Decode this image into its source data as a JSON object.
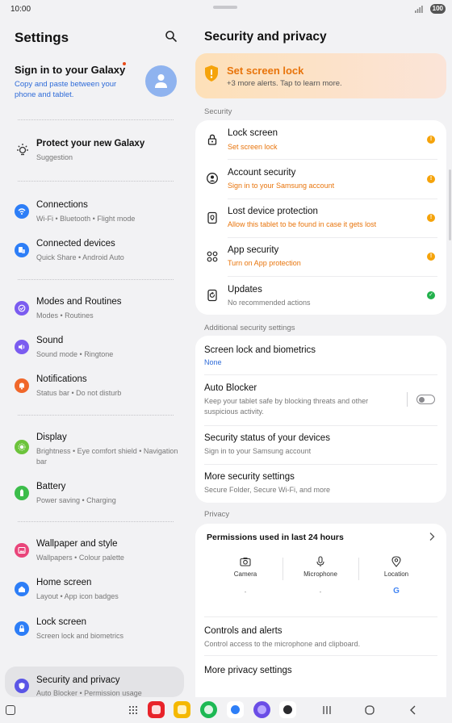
{
  "status": {
    "time": "10:00",
    "battery": "100"
  },
  "left": {
    "title": "Settings",
    "signin": {
      "title": "Sign in to your Galaxy",
      "subtitle": "Copy and paste between your phone and tablet."
    },
    "suggestion": {
      "title": "Protect your new Galaxy",
      "subtitle": "Suggestion"
    },
    "items": [
      {
        "title": "Connections",
        "subtitle": "Wi-Fi  •  Bluetooth  •  Flight mode",
        "color": "#2d7ef7"
      },
      {
        "title": "Connected devices",
        "subtitle": "Quick Share  •  Android Auto",
        "color": "#2d7ef7"
      },
      {
        "title": "Modes and Routines",
        "subtitle": "Modes  •  Routines",
        "color": "#7b5cf0"
      },
      {
        "title": "Sound",
        "subtitle": "Sound mode  •  Ringtone",
        "color": "#7b5cf0"
      },
      {
        "title": "Notifications",
        "subtitle": "Status bar  •  Do not disturb",
        "color": "#f0672a"
      },
      {
        "title": "Display",
        "subtitle": "Brightness  •  Eye comfort shield  •  Navigation bar",
        "color": "#6cc33b"
      },
      {
        "title": "Battery",
        "subtitle": "Power saving  •  Charging",
        "color": "#3cbd4a"
      },
      {
        "title": "Wallpaper and style",
        "subtitle": "Wallpapers  •  Colour palette",
        "color": "#e9457a"
      },
      {
        "title": "Home screen",
        "subtitle": "Layout  •  App icon badges",
        "color": "#2d7ef7"
      },
      {
        "title": "Lock screen",
        "subtitle": "Screen lock and biometrics",
        "color": "#2d7ef7"
      },
      {
        "title": "Security and privacy",
        "subtitle": "Auto Blocker  •  Permission usage",
        "color": "#5a55e6"
      }
    ]
  },
  "right": {
    "title": "Security and privacy",
    "alert": {
      "title": "Set screen lock",
      "subtitle": "+3 more alerts. Tap to learn more."
    },
    "security_label": "Security",
    "security_items": [
      {
        "title": "Lock screen",
        "subtitle": "Set screen lock",
        "status": "warning",
        "icon": "lock-icon"
      },
      {
        "title": "Account security",
        "subtitle": "Sign in to your Samsung account",
        "status": "warning",
        "icon": "account-icon"
      },
      {
        "title": "Lost device protection",
        "subtitle": "Allow this tablet to be found in case it gets lost",
        "status": "warning",
        "icon": "lost-device-icon"
      },
      {
        "title": "App security",
        "subtitle": "Turn on App protection",
        "status": "warning",
        "icon": "apps-icon"
      },
      {
        "title": "Updates",
        "subtitle": "No recommended actions",
        "status": "ok",
        "icon": "update-icon"
      }
    ],
    "additional_label": "Additional security settings",
    "additional": {
      "biometrics": {
        "title": "Screen lock and biometrics",
        "subtitle": "None"
      },
      "auto_blocker": {
        "title": "Auto Blocker",
        "subtitle": "Keep your tablet safe by blocking threats and other suspicious activity.",
        "enabled": false
      },
      "device_status": {
        "title": "Security status of your devices",
        "subtitle": "Sign in to your Samsung account"
      },
      "more_security": {
        "title": "More security settings",
        "subtitle": "Secure Folder, Secure Wi-Fi, and more"
      }
    },
    "privacy_label": "Privacy",
    "permissions": {
      "title": "Permissions used in last 24 hours",
      "columns": [
        {
          "label": "Camera",
          "value": "-"
        },
        {
          "label": "Microphone",
          "value": "-"
        },
        {
          "label": "Location",
          "value": "G"
        }
      ]
    },
    "controls": {
      "title": "Controls and alerts",
      "subtitle": "Control access to the microphone and clipboard."
    },
    "more_privacy": {
      "title": "More privacy settings"
    }
  },
  "taskbar": {
    "apps": [
      {
        "name": "app-1",
        "color": "#e8232a"
      },
      {
        "name": "app-2",
        "color": "#f5b800"
      },
      {
        "name": "phone",
        "color": "#1db954"
      },
      {
        "name": "messages",
        "color": "#2d7ef7"
      },
      {
        "name": "internet",
        "color": "#6b4de6"
      },
      {
        "name": "camera",
        "color": "#2a2a2e"
      }
    ]
  }
}
